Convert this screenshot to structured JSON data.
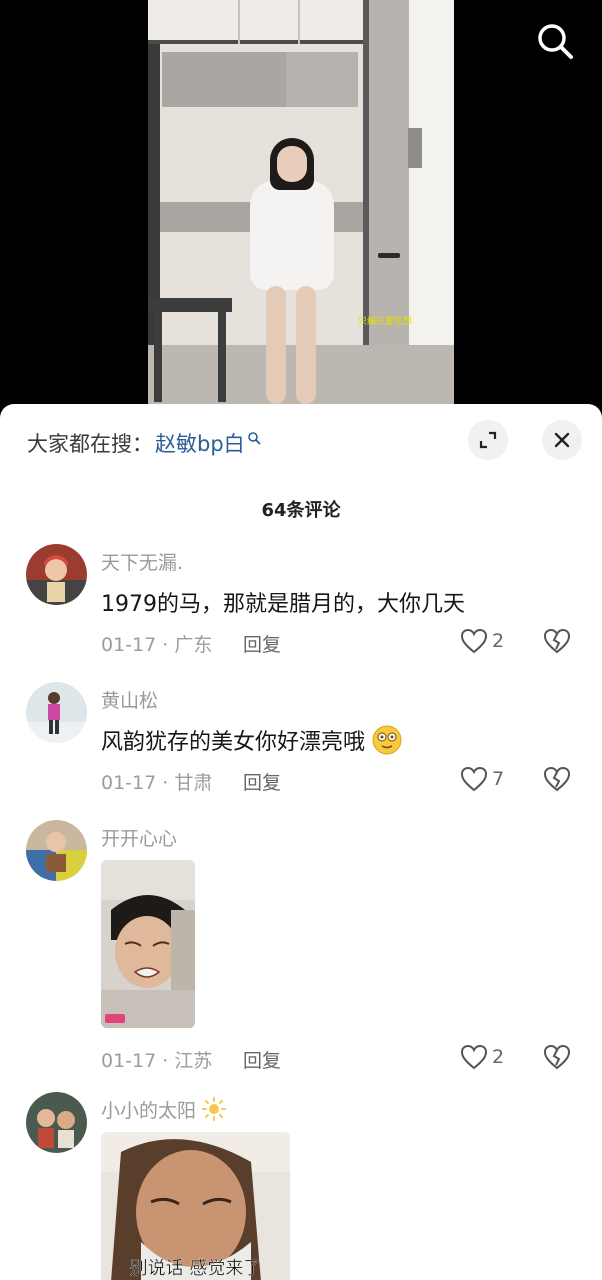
{
  "video": {
    "watermark": "只编只要您想"
  },
  "search_suggest": {
    "label": "大家都在搜：",
    "term": "赵敏bp白"
  },
  "comment_count": "64条评论",
  "comments": [
    {
      "name": "天下无漏.",
      "text": "1979的马，那就是腊月的，大你几天",
      "date_loc": "01-17 · 广东",
      "reply": "回复",
      "likes": "2"
    },
    {
      "name": "黄山松",
      "text": "风韵犹存的美女你好漂亮哦",
      "date_loc": "01-17 · 甘肃",
      "reply": "回复",
      "likes": "7"
    },
    {
      "name": "开开心心",
      "date_loc": "01-17 · 江苏",
      "reply": "回复",
      "likes": "2"
    },
    {
      "name": "小小的太阳",
      "image_caption": "别说话 感觉来了"
    }
  ],
  "colors": {
    "accent_link": "#2a5d9a",
    "muted_text": "#9a9a9a",
    "primary_text": "#161616"
  },
  "icons": [
    "search-icon",
    "search-magnifier-icon",
    "expand-icon",
    "close-icon",
    "heart-icon",
    "broken-heart-icon",
    "smiley-emoji-icon",
    "sun-emoji-icon"
  ]
}
